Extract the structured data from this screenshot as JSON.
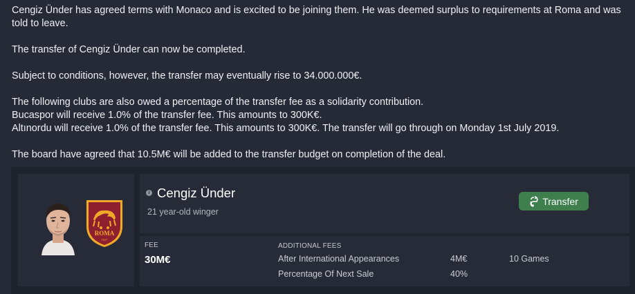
{
  "message": {
    "line1": "Cengiz Ünder has agreed terms with Monaco and is excited to be joining them. He was deemed surplus to requirements at Roma and was",
    "line2": "told to leave.",
    "line3": "The transfer of Cengiz Ünder can now be completed.",
    "line4": "Subject to conditions, however, the transfer may eventually rise to 34.000.000€.",
    "line5": "The following clubs are also owed a percentage of the transfer fee as a solidarity contribution.",
    "line6": "Bucaspor will receive 1.0% of the transfer fee. This amounts to 300K€.",
    "line7": "Altınordu will receive 1.0% of the transfer fee. This amounts to 300K€. The transfer will go through on Monday 1st July 2019.",
    "line8": "The board have agreed that 10.5M€ will be added to the transfer budget on completion of the deal."
  },
  "player": {
    "name": "Cengiz Ünder",
    "description": "21 year-old winger",
    "info_icon": "i"
  },
  "crest": {
    "text": "ROMA",
    "year": "1927",
    "colors": {
      "red": "#8e1f2f",
      "gold": "#f0a929"
    }
  },
  "transfer_button": {
    "label": "Transfer",
    "icon": "transfer-icon",
    "color": "#3e7f4d"
  },
  "fees": {
    "fee_label": "FEE",
    "fee_value": "30M€",
    "additional_label": "ADDITIONAL FEES",
    "rows": [
      {
        "name": "After International Appearances",
        "amount": "4M€",
        "condition": "10 Games"
      },
      {
        "name": "Percentage Of Next Sale",
        "amount": "40%",
        "condition": ""
      }
    ]
  }
}
